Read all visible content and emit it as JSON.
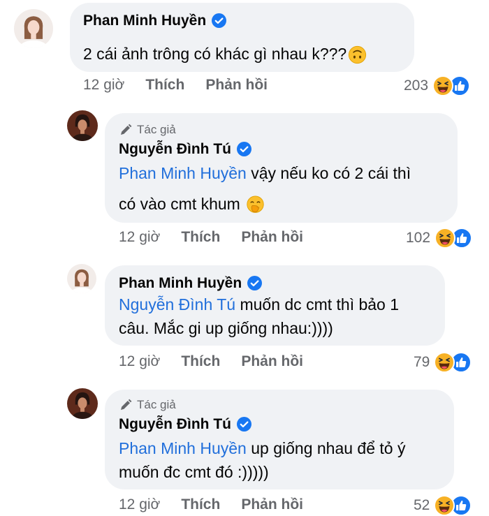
{
  "comments": [
    {
      "author": "Phan Minh Huyền",
      "mention": "",
      "text": "2 cái ảnh trông có khác gì nhau k???",
      "emoji": "upside-down-face",
      "time": "12 giờ",
      "like_label": "Thích",
      "reply_label": "Phản hồi",
      "reactions": "203"
    },
    {
      "badge": "Tác giả",
      "author": "Nguyễn Đình Tú",
      "mention": "Phan Minh Huyền",
      "text_line1": " vậy nếu ko có 2 cái thì",
      "text_line2": "có vào cmt khum ",
      "emoji": "face-with-hand-over-mouth",
      "time": "12 giờ",
      "like_label": "Thích",
      "reply_label": "Phản hồi",
      "reactions": "102"
    },
    {
      "author": "Phan Minh Huyền",
      "mention": "Nguyễn Đình Tú",
      "text_line1": " muốn dc cmt thì bảo 1",
      "text_line2": "câu. Mắc gi up giống nhau:))))",
      "time": "12 giờ",
      "like_label": "Thích",
      "reply_label": "Phản hồi",
      "reactions": "79"
    },
    {
      "badge": "Tác giả",
      "author": "Nguyễn Đình Tú",
      "mention": "Phan Minh Huyền",
      "text_line1": " up giống nhau để tỏ ý",
      "text_line2": "muốn đc cmt đó :)))))",
      "time": "12 giờ",
      "like_label": "Thích",
      "reply_label": "Phản hồi",
      "reactions": "52"
    }
  ],
  "colors": {
    "bubble": "#f0f2f5",
    "mention": "#216fdb",
    "meta": "#65676b",
    "verified": "#1877f2",
    "haha": "#f7b125",
    "like": "#1877f2"
  }
}
